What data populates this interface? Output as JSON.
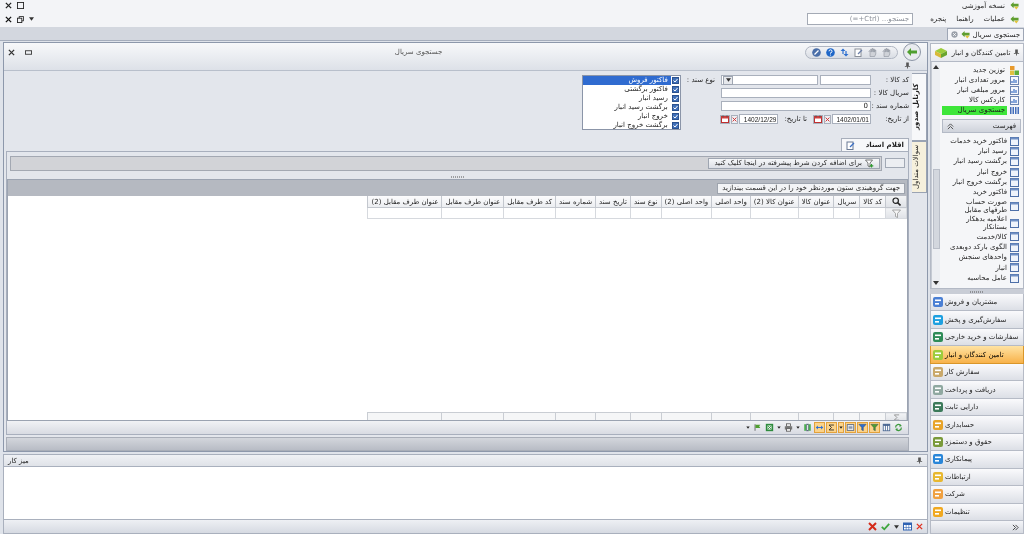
{
  "app": {
    "title": "نسخه آموزشی"
  },
  "menu": {
    "items": [
      "عملیات",
      "راهنما",
      "پنجره"
    ],
    "search": {
      "placeholder": "جستجو... (Ctrl+=)"
    }
  },
  "document_tabs": [
    {
      "label": "جستجوی سریال",
      "selected": true
    }
  ],
  "window": {
    "title": "جستجوی سریال"
  },
  "side_tabs": [
    {
      "label": "کارتابل صدور",
      "selected": true
    },
    {
      "label": "سوالات متداول",
      "selected": false
    }
  ],
  "filters": {
    "item_code": {
      "label": "کد کالا :"
    },
    "serial": {
      "label": "سریال کالا :"
    },
    "doc_number": {
      "label": "شماره سند :",
      "value": "0"
    },
    "date_from": {
      "label": "از تاریخ:",
      "value": "1402/01/01"
    },
    "date_to": {
      "label": "تا تاریخ:",
      "value": "1402/12/29"
    },
    "doc_type": {
      "label": "نوع سند :",
      "options": [
        {
          "label": "فاکتور فروش",
          "checked": true,
          "selected": true
        },
        {
          "label": "فاکتور برگشتی",
          "checked": true,
          "selected": false
        },
        {
          "label": "رسید انبار",
          "checked": true,
          "selected": false
        },
        {
          "label": "برگشت رسید انبار",
          "checked": true,
          "selected": false
        },
        {
          "label": "خروج انبار",
          "checked": true,
          "selected": false
        },
        {
          "label": "برگشت خروج انبار",
          "checked": true,
          "selected": false
        }
      ]
    }
  },
  "content_tabs": [
    {
      "label": "اقلام اسناد",
      "selected": true
    }
  ],
  "advanced_filter": {
    "label": "برای اضافه کردن شرط پیشرفته در اینجا کلیک کنید"
  },
  "grid": {
    "group_hint": "جهت گروهبندی ستون موردنظر خود را در این قسمت بیندازید",
    "columns": [
      "کد کالا",
      "سریال",
      "عنوان کالا",
      "عنوان کالا (2)",
      "واحد اصلی",
      "واحد اصلی (2)",
      "نوع سند",
      "تاریخ سند",
      "شماره سند",
      "کد طرف مقابل",
      "عنوان طرف مقابل",
      "عنوان طرف مقابل (2)"
    ],
    "toolbar": [
      {
        "kind": "refresh",
        "on": false
      },
      {
        "kind": "columns",
        "on": false
      },
      {
        "kind": "auto-filter",
        "on": true
      },
      {
        "kind": "filter",
        "on": true
      },
      {
        "kind": "group",
        "on": true
      },
      {
        "kind": "caret",
        "on": true
      },
      {
        "kind": "sum",
        "on": true
      },
      {
        "kind": "best-fit",
        "on": true
      },
      {
        "kind": "bars",
        "on": false
      },
      {
        "kind": "caret",
        "on": false
      },
      {
        "kind": "print",
        "on": false
      },
      {
        "kind": "caret",
        "on": false
      },
      {
        "kind": "excel",
        "on": false
      },
      {
        "kind": "flag",
        "on": false
      },
      {
        "kind": "caret",
        "on": false
      }
    ]
  },
  "workspace": {
    "title": "میز کار"
  },
  "sidebar": {
    "title": "تامین کنندگان و انبار",
    "tasks": [
      {
        "label": "توزین جدید",
        "kind": "scale",
        "selected": false
      },
      {
        "label": "مرور تعدادی انبار",
        "kind": "report",
        "selected": false
      },
      {
        "label": "مرور مبلغی انبار",
        "kind": "report",
        "selected": false
      },
      {
        "label": "کاردکس کالا",
        "kind": "report",
        "selected": false
      },
      {
        "label": "جستجوی سریال",
        "kind": "barcode",
        "selected": true
      }
    ],
    "list_title": "فهرست",
    "list": [
      "فاکتور خرید خدمات",
      "رسید انبار",
      "برگشت رسید انبار",
      "خروج انبار",
      "برگشت خروج انبار",
      "فاکتور خرید",
      "صورت حساب طرفهای مقابل",
      "اعلامیه بدهکار بستانکار",
      "کالا/خدمت",
      "الگوی بارکد دوبعدی",
      "واحدهای سنجش",
      "انبار",
      "عامل محاسبه"
    ],
    "modules": [
      {
        "label": "مشتریان و فروش",
        "color": "#4a7fd4",
        "selected": false
      },
      {
        "label": "سفارش‌گیری و پخش",
        "color": "#1ea0e0",
        "selected": false
      },
      {
        "label": "سفارشات و خرید خارجی",
        "color": "#2e8b57",
        "selected": false
      },
      {
        "label": "تامین کنندگان و انبار",
        "color": "#9ccc3c",
        "selected": true
      },
      {
        "label": "سفارش کار",
        "color": "#c9a86a",
        "selected": false
      },
      {
        "label": "دریافت و پرداخت",
        "color": "#8fa8a0",
        "selected": false
      },
      {
        "label": "دارایی ثابت",
        "color": "#3c7a5a",
        "selected": false
      },
      {
        "label": "حسابداری",
        "color": "#e8a42a",
        "selected": false
      },
      {
        "label": "حقوق و دستمزد",
        "color": "#7a9a3a",
        "selected": false
      },
      {
        "label": "پیمانکاری",
        "color": "#2a86d8",
        "selected": false
      },
      {
        "label": "ارتباطات",
        "color": "#e8b830",
        "selected": false
      },
      {
        "label": "شرکت",
        "color": "#f0a040",
        "selected": false
      },
      {
        "label": "تنظیمات",
        "color": "#f0a820",
        "selected": false
      }
    ]
  }
}
